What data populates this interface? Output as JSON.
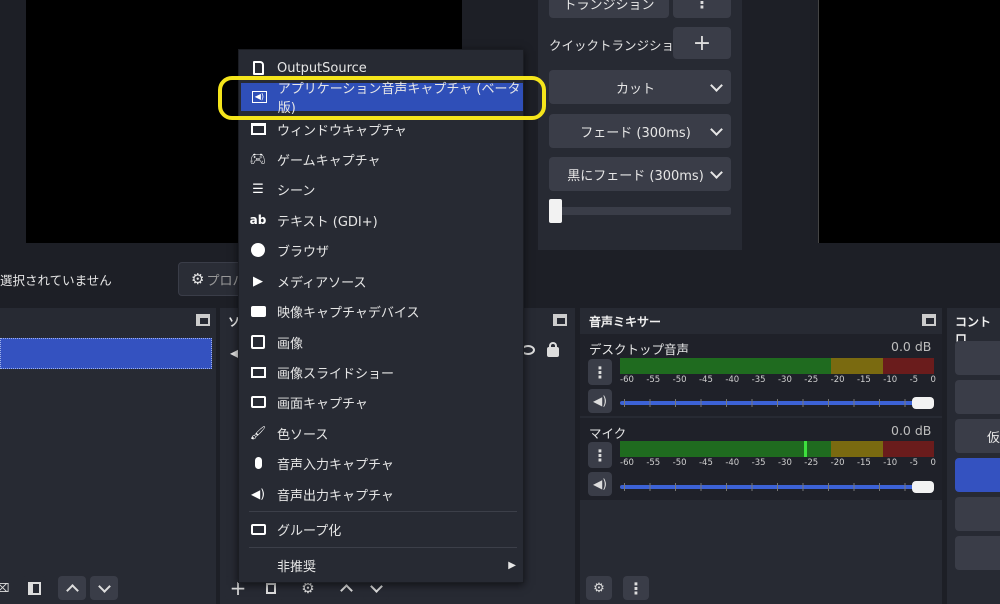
{
  "transitions": {
    "top_button_label": "トランジション",
    "more_icon": "vertical-dots-icon",
    "quick_label": "クイックトランジション",
    "add_icon": "plus-icon",
    "items": [
      "カット",
      "フェード (300ms)",
      "黒にフェード (300ms)"
    ]
  },
  "status_bar": {
    "no_source_text": "選択されていません",
    "properties_partial": "プロパ"
  },
  "context_menu": {
    "items": [
      {
        "label": "OutputSource",
        "icon": "file-icon"
      },
      {
        "label": "アプリケーション音声キャプチャ (ベータ版)",
        "icon": "speaker-box-icon",
        "highlighted": true
      },
      {
        "label": "ウィンドウキャプチャ",
        "icon": "window-icon"
      },
      {
        "label": "ゲームキャプチャ",
        "icon": "gamepad-icon"
      },
      {
        "label": "シーン",
        "icon": "list-icon"
      },
      {
        "label": "テキスト (GDI+)",
        "icon": "text-ab-icon"
      },
      {
        "label": "ブラウザ",
        "icon": "globe-icon"
      },
      {
        "label": "メディアソース",
        "icon": "play-icon"
      },
      {
        "label": "映像キャプチャデバイス",
        "icon": "camera-icon"
      },
      {
        "label": "画像",
        "icon": "image-icon"
      },
      {
        "label": "画像スライドショー",
        "icon": "slideshow-icon"
      },
      {
        "label": "画面キャプチャ",
        "icon": "monitor-icon"
      },
      {
        "label": "色ソース",
        "icon": "brush-icon"
      },
      {
        "label": "音声入力キャプチャ",
        "icon": "microphone-icon"
      },
      {
        "label": "音声出力キャプチャ",
        "icon": "speaker-icon"
      },
      {
        "label": "グループ化",
        "icon": "folder-icon"
      },
      {
        "label": "非推奨",
        "icon": "",
        "submenu": true
      }
    ],
    "highlight_border_color": "#f5e51b",
    "highlight_bg_color": "#2f4fb8"
  },
  "audio_mixer": {
    "title": "音声ミキサー",
    "channels": [
      {
        "name": "デスクトップ音声",
        "level": "0.0 dB"
      },
      {
        "name": "マイク",
        "level": "0.0 dB"
      }
    ],
    "scale": [
      "-60",
      "-55",
      "-50",
      "-45",
      "-40",
      "-35",
      "-30",
      "-25",
      "-20",
      "-15",
      "-10",
      "-5",
      "0"
    ]
  },
  "controls": {
    "title_partial": "コントロ",
    "partial_button": "仮"
  },
  "sources_dock_title_partial": "ソ",
  "colors": {
    "accent_blue": "#3452c0",
    "meter_green": "#1f6b1f",
    "meter_yellow": "#7a6a10",
    "meter_red": "#6a1c1c"
  }
}
